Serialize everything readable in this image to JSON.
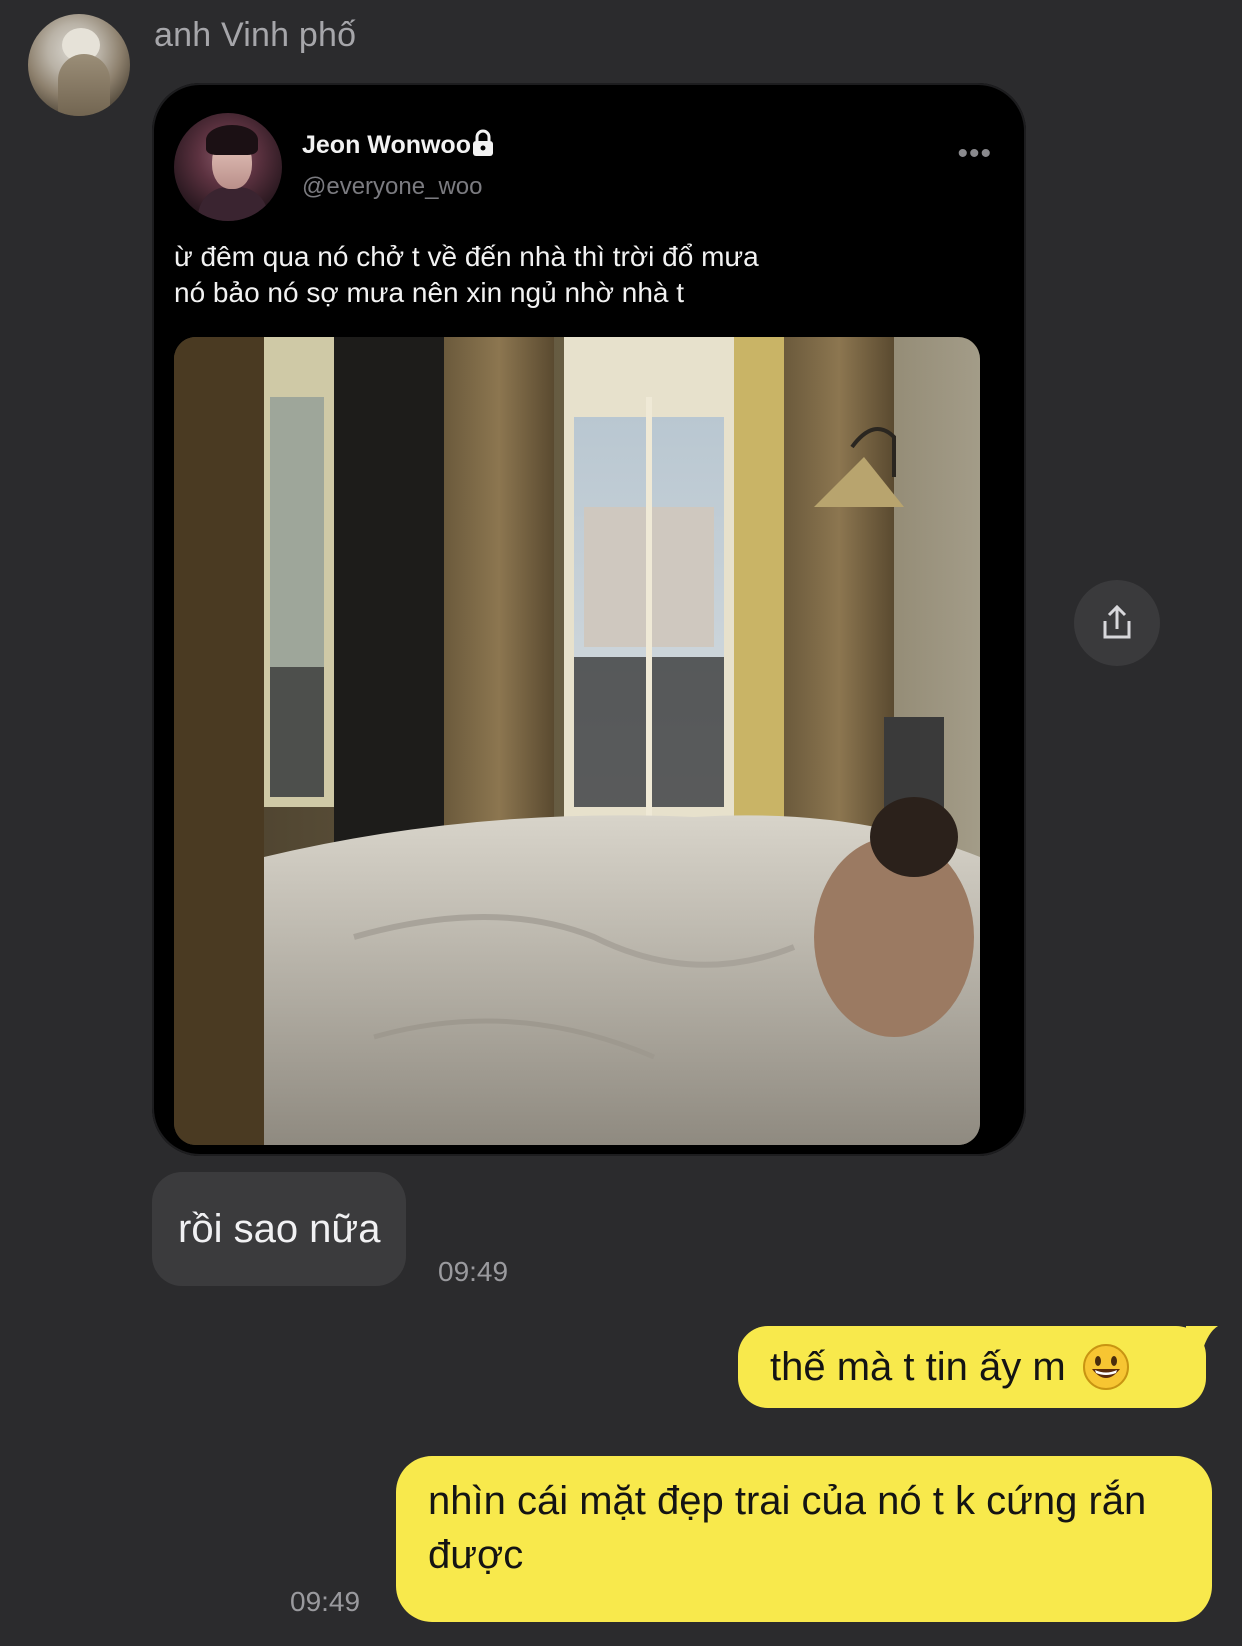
{
  "chat": {
    "sender_name": "anh Vinh phố",
    "incoming_time": "09:49",
    "outgoing_time": "09:49"
  },
  "tweet": {
    "display_name": "Jeon Wonwoo",
    "handle": "@everyone_woo",
    "more_label": "•••",
    "text_lines": [
      "ừ đêm qua nó chở t về đến nhà thì trời đổ mưa",
      "nó bảo nó sợ mưa nên xin ngủ nhờ nhà t"
    ]
  },
  "messages": {
    "incoming": [
      {
        "text": "rồi sao nữa"
      }
    ],
    "outgoing": [
      {
        "text": "thế mà t tin ấy m"
      },
      {
        "text": "nhìn cái mặt đẹp trai của nó t k cứng rắn được"
      }
    ]
  },
  "icons": {
    "share": "share-icon",
    "lock": "lock-icon",
    "emoji": "smiley-emoji-icon"
  },
  "colors": {
    "background": "#2b2b2d",
    "incoming_bubble": "#3b3b3d",
    "outgoing_bubble": "#f8e94c",
    "tweet_card": "#000000"
  }
}
